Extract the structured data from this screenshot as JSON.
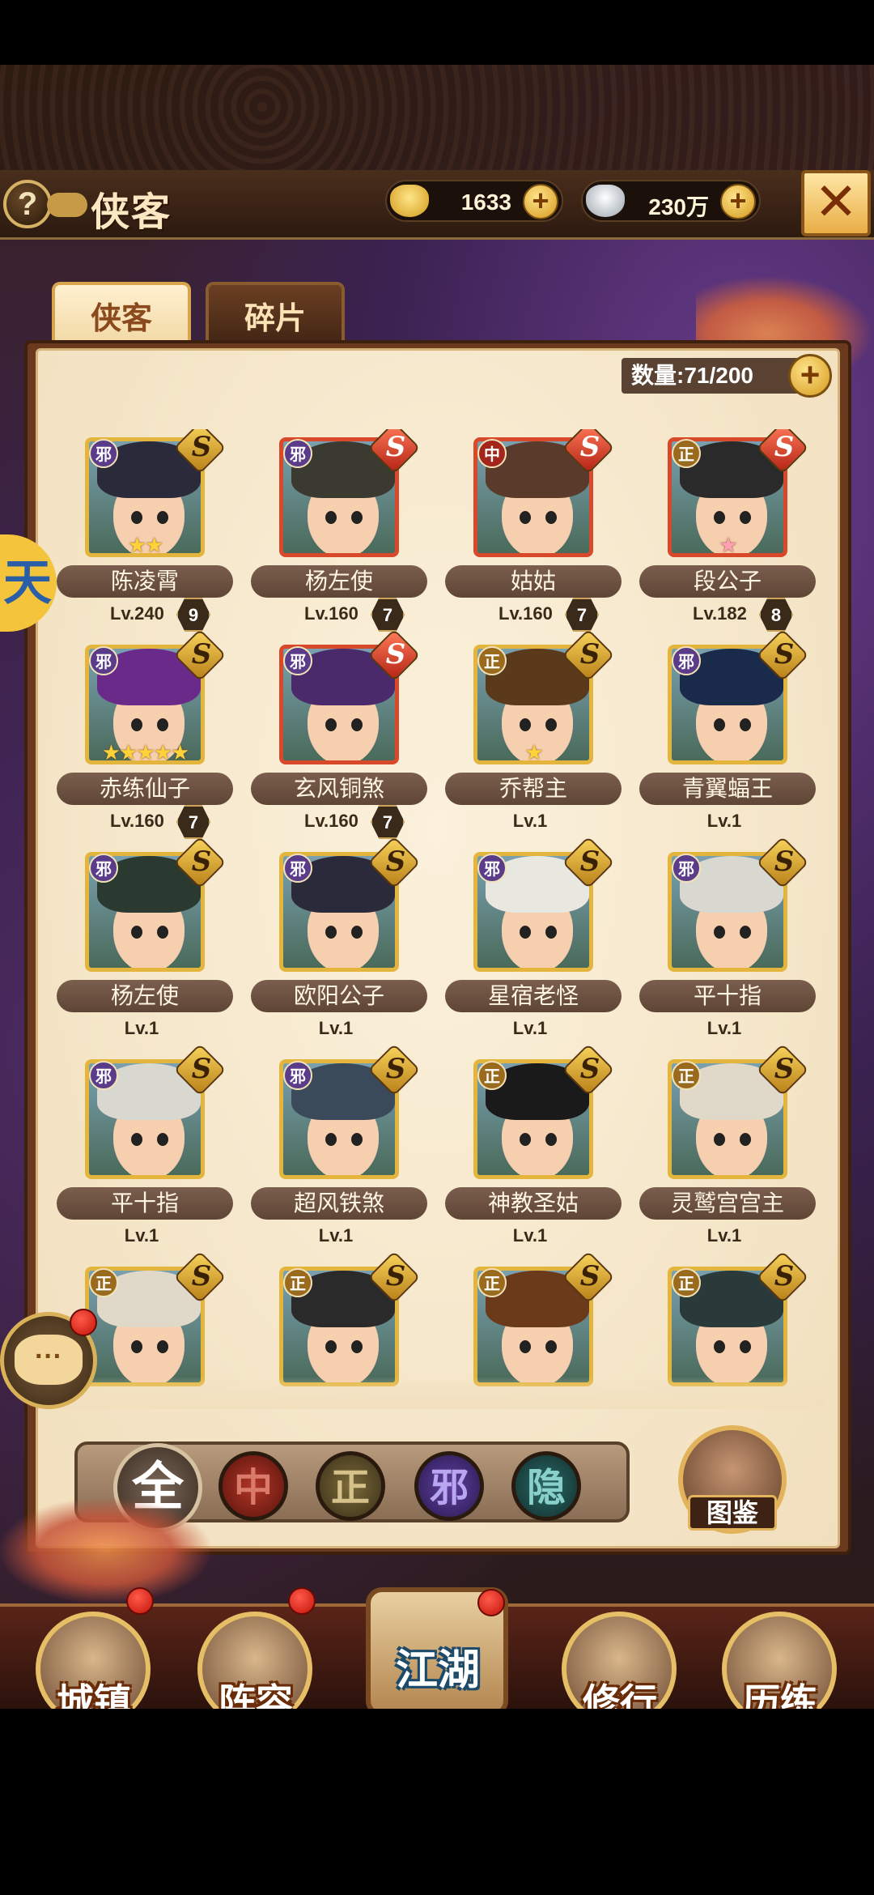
{
  "header": {
    "help_label": "?",
    "title": "侠客",
    "gold": {
      "icon": "gold-ingot-icon",
      "value": "1633",
      "plus": "+"
    },
    "silver": {
      "icon": "silver-ingot-icon",
      "value": "230万",
      "plus": "+"
    },
    "close_label": "✕"
  },
  "tabs": [
    {
      "label": "侠客",
      "active": true
    },
    {
      "label": "碎片",
      "active": false
    }
  ],
  "count": {
    "label": "数量:71/200",
    "plus": "+"
  },
  "heroes": [
    {
      "name": "陈凌霄",
      "level": "Lv.240",
      "badge": "9",
      "faction": "邪",
      "grade": "S",
      "stars": "★★",
      "frame": "gold"
    },
    {
      "name": "杨左使",
      "level": "Lv.160",
      "badge": "7",
      "faction": "邪",
      "grade": "S",
      "stars": "",
      "frame": "red"
    },
    {
      "name": "姑姑",
      "level": "Lv.160",
      "badge": "7",
      "faction": "中",
      "grade": "S",
      "stars": "",
      "frame": "red"
    },
    {
      "name": "段公子",
      "level": "Lv.182",
      "badge": "8",
      "faction": "正",
      "grade": "S",
      "stars": "★",
      "frame": "red",
      "star_color": "pink"
    },
    {
      "name": "赤练仙子",
      "level": "Lv.160",
      "badge": "7",
      "faction": "邪",
      "grade": "S",
      "stars": "★★★★★",
      "frame": "gold"
    },
    {
      "name": "玄风铜煞",
      "level": "Lv.160",
      "badge": "7",
      "faction": "邪",
      "grade": "S",
      "stars": "",
      "frame": "red"
    },
    {
      "name": "乔帮主",
      "level": "Lv.1",
      "badge": "",
      "faction": "正",
      "grade": "S",
      "stars": "★",
      "frame": "gold"
    },
    {
      "name": "青翼蝠王",
      "level": "Lv.1",
      "badge": "",
      "faction": "邪",
      "grade": "S",
      "stars": "",
      "frame": "gold"
    },
    {
      "name": "杨左使",
      "level": "Lv.1",
      "badge": "",
      "faction": "邪",
      "grade": "S",
      "stars": "",
      "frame": "gold"
    },
    {
      "name": "欧阳公子",
      "level": "Lv.1",
      "badge": "",
      "faction": "邪",
      "grade": "S",
      "stars": "",
      "frame": "gold"
    },
    {
      "name": "星宿老怪",
      "level": "Lv.1",
      "badge": "",
      "faction": "邪",
      "grade": "S",
      "stars": "",
      "frame": "gold"
    },
    {
      "name": "平十指",
      "level": "Lv.1",
      "badge": "",
      "faction": "邪",
      "grade": "S",
      "stars": "",
      "frame": "gold"
    },
    {
      "name": "平十指",
      "level": "Lv.1",
      "badge": "",
      "faction": "邪",
      "grade": "S",
      "stars": "",
      "frame": "gold"
    },
    {
      "name": "超风铁煞",
      "level": "Lv.1",
      "badge": "",
      "faction": "邪",
      "grade": "S",
      "stars": "",
      "frame": "gold"
    },
    {
      "name": "神教圣姑",
      "level": "Lv.1",
      "badge": "",
      "faction": "正",
      "grade": "S",
      "stars": "",
      "frame": "gold"
    },
    {
      "name": "灵鹫宫宫主",
      "level": "Lv.1",
      "badge": "",
      "faction": "正",
      "grade": "S",
      "stars": "",
      "frame": "gold"
    },
    {
      "name": "",
      "level": "",
      "badge": "",
      "faction": "正",
      "grade": "S",
      "stars": "",
      "frame": "gold"
    },
    {
      "name": "",
      "level": "",
      "badge": "",
      "faction": "正",
      "grade": "S",
      "stars": "",
      "frame": "gold"
    },
    {
      "name": "",
      "level": "",
      "badge": "",
      "faction": "正",
      "grade": "S",
      "stars": "",
      "frame": "gold"
    },
    {
      "name": "",
      "level": "",
      "badge": "",
      "faction": "正",
      "grade": "S",
      "stars": "",
      "frame": "gold"
    }
  ],
  "filters": {
    "all": "全",
    "zhong": "中",
    "zheng": "正",
    "xie": "邪",
    "yin": "隐"
  },
  "atlas_label": "图鉴",
  "chat_label": "···",
  "side_tag": "天",
  "nav": {
    "town": "城镇",
    "lineup": "阵容",
    "jianghu": "江湖",
    "practice": "修行",
    "training": "历练"
  }
}
